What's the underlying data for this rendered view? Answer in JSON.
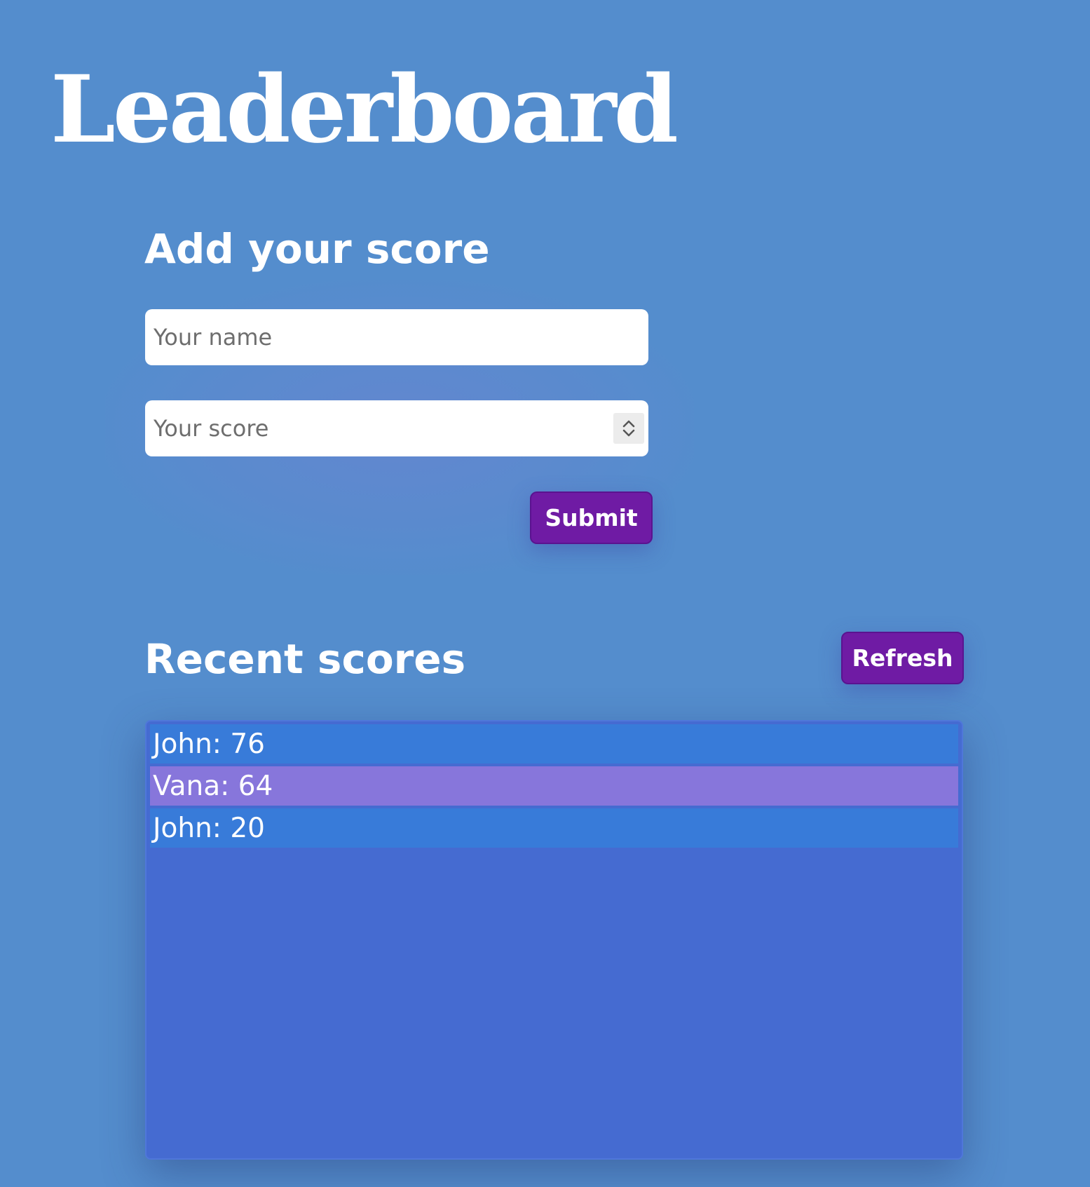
{
  "page": {
    "title": "Leaderboard"
  },
  "add_score": {
    "heading": "Add your score",
    "name_placeholder": "Your name",
    "score_placeholder": "Your score",
    "submit_label": "Submit"
  },
  "recent": {
    "heading": "Recent scores",
    "refresh_label": "Refresh",
    "items": [
      {
        "text": "John: 76"
      },
      {
        "text": "Vana: 64"
      },
      {
        "text": "John: 20"
      }
    ]
  },
  "colors": {
    "background": "#548dcd",
    "button": "#6f1ba4",
    "panel": "#456bd1",
    "row": "#387bd9",
    "row_alt": "#8776db"
  },
  "icons": {
    "spinner_up": "chevron-up-icon",
    "spinner_down": "chevron-down-icon"
  }
}
